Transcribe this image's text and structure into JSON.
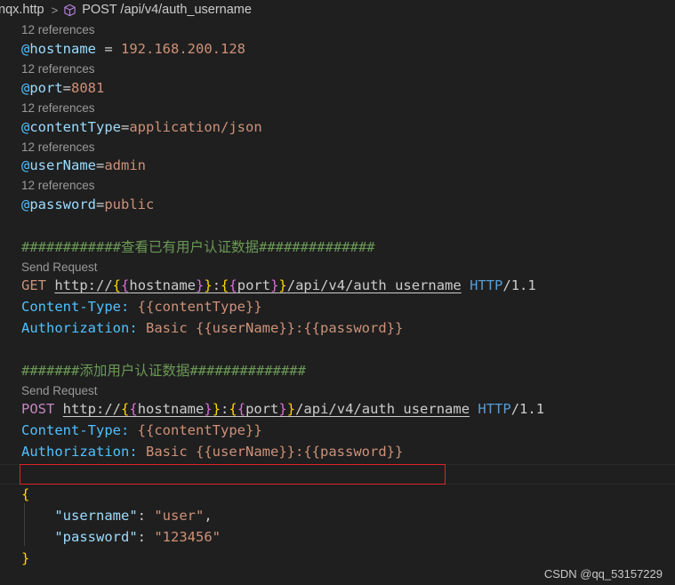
{
  "breadcrumb": {
    "file": "nqx.http",
    "separator": ">",
    "request": "POST /api/v4/auth_username"
  },
  "code_lens": {
    "references": "12 references",
    "send_request": "Send Request"
  },
  "variables": [
    {
      "at": "@",
      "name": "hostname",
      "assign": " = ",
      "value": "192.168.200.128"
    },
    {
      "at": "@",
      "name": "port",
      "assign": "=",
      "value": "8081"
    },
    {
      "at": "@",
      "name": "contentType",
      "assign": "=",
      "value": "application/json"
    },
    {
      "at": "@",
      "name": "userName",
      "assign": "=",
      "value": "admin"
    },
    {
      "at": "@",
      "name": "password",
      "assign": "=",
      "value": "public"
    }
  ],
  "requests": [
    {
      "comment": "############查看已有用户认证数据##############",
      "method": "GET",
      "url_prefix": "http://",
      "host_var": "hostname",
      "colon": ":",
      "port_var": "port",
      "path": "/api/v4/auth_username",
      "protocol": "HTTP",
      "version": "/1.1",
      "content_type_label": "Content-Type:",
      "content_type_value": "{{contentType}}",
      "auth_label": "Authorization:",
      "auth_scheme": "Basic",
      "auth_value": "{{userName}}:{{password}}"
    },
    {
      "comment": "#######添加用户认证数据##############",
      "method": "POST",
      "url_prefix": "http://",
      "host_var": "hostname",
      "colon": ":",
      "port_var": "port",
      "path": "/api/v4/auth_username",
      "protocol": "HTTP",
      "version": "/1.1",
      "content_type_label": "Content-Type:",
      "content_type_value": "{{contentType}}",
      "auth_label": "Authorization:",
      "auth_scheme": "Basic",
      "auth_value": "{{userName}}:{{password}}"
    }
  ],
  "body": {
    "open": "{",
    "close": "}",
    "fields": [
      {
        "key": "\"username\"",
        "sep": ": ",
        "value": "\"user\"",
        "trail": ","
      },
      {
        "key": "\"password\"",
        "sep": ": ",
        "value": "\"123456\"",
        "trail": ""
      }
    ]
  },
  "watermark": "CSDN @qq_53157229",
  "colors": {
    "background": "#1f1f1f",
    "highlight_border": "#d9252b",
    "variable": "#9cdcfe",
    "string": "#ce9178",
    "comment": "#6a9955",
    "keyword": "#569cd6",
    "post_method": "#c586c0",
    "brace_gold": "#ffd700",
    "brace_pink": "#da70d6"
  }
}
